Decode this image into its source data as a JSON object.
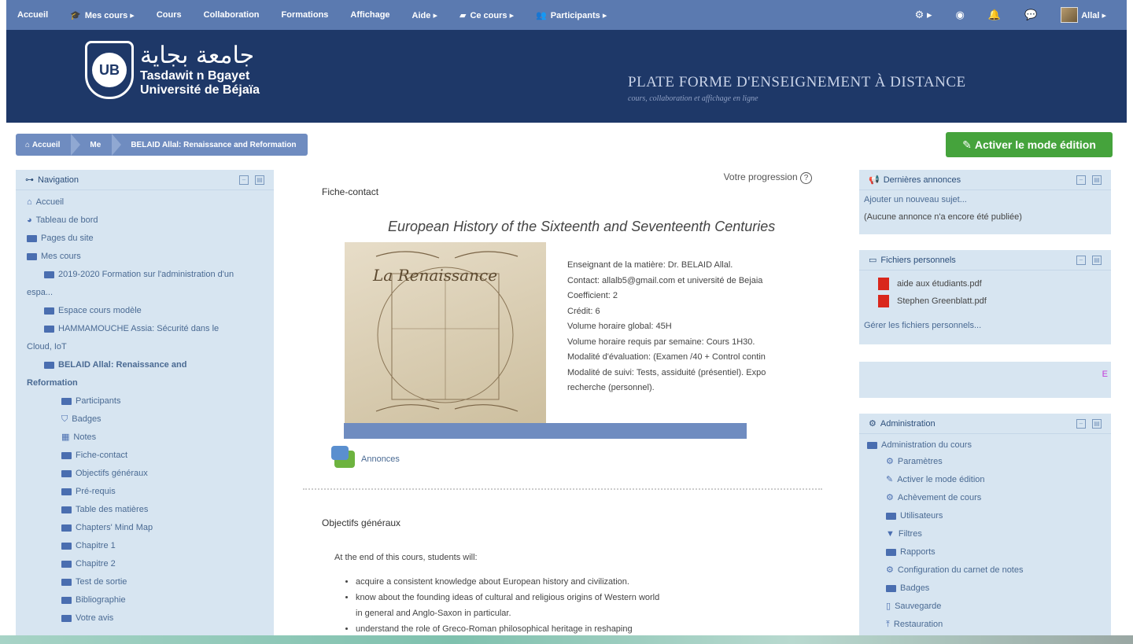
{
  "topbar": {
    "items": [
      {
        "label": "Accueil",
        "icon": ""
      },
      {
        "label": "Mes cours ▸",
        "icon": "mortarboard-icon"
      },
      {
        "label": "Cours",
        "icon": ""
      },
      {
        "label": "Collaboration",
        "icon": ""
      },
      {
        "label": "Formations",
        "icon": ""
      },
      {
        "label": "Affichage",
        "icon": ""
      },
      {
        "label": "Aide ▸",
        "icon": ""
      },
      {
        "label": "Ce cours ▸",
        "icon": "book-icon"
      },
      {
        "label": "Participants ▸",
        "icon": "users-icon"
      }
    ],
    "user_label": "Allal ▸"
  },
  "banner": {
    "arabic": "جامعة بجاية",
    "line1": "Tasdawit n Bgayet",
    "line2": "Université de Béjaïa",
    "title": "PLATE FORME D'ENSEIGNEMENT À DISTANCE",
    "subtitle": "cours, collaboration et affichage en ligne"
  },
  "breadcrumb": [
    "Accueil",
    "Me",
    "BELAID Allal: Renaissance and Reformation"
  ],
  "edit_button": "Activer le mode édition",
  "navigation": {
    "title": "Navigation",
    "items": [
      {
        "label": "Accueil",
        "indent": 0,
        "icon": "home"
      },
      {
        "label": "Tableau de bord",
        "indent": 0,
        "icon": "dashboard"
      },
      {
        "label": "Pages du site",
        "indent": 0,
        "icon": "folder"
      },
      {
        "label": "Mes cours",
        "indent": 0,
        "icon": "folder-open"
      },
      {
        "label": "2019-2020 Formation sur l'administration d'un",
        "indent": 1,
        "icon": "folder"
      },
      {
        "label": "espa...",
        "indent": 1,
        "icon": ""
      },
      {
        "label": "Espace cours modèle",
        "indent": 1,
        "icon": "folder"
      },
      {
        "label": "HAMMAMOUCHE Assia: Sécurité dans le",
        "indent": 1,
        "icon": "folder"
      },
      {
        "label": "Cloud, IoT",
        "indent": 1,
        "icon": ""
      },
      {
        "label": "BELAID Allal: Renaissance and",
        "indent": 1,
        "icon": "folder-open",
        "bold": true
      },
      {
        "label": "Reformation",
        "indent": 1,
        "icon": "",
        "bold": true
      },
      {
        "label": "Participants",
        "indent": 2,
        "icon": "folder"
      },
      {
        "label": "Badges",
        "indent": 2,
        "icon": "shield"
      },
      {
        "label": "Notes",
        "indent": 2,
        "icon": "table"
      },
      {
        "label": "Fiche-contact",
        "indent": 2,
        "icon": "folder"
      },
      {
        "label": "Objectifs généraux",
        "indent": 2,
        "icon": "folder"
      },
      {
        "label": "Pré-requis",
        "indent": 2,
        "icon": "folder"
      },
      {
        "label": "Table des matières",
        "indent": 2,
        "icon": "folder"
      },
      {
        "label": "Chapters' Mind Map",
        "indent": 2,
        "icon": "folder"
      },
      {
        "label": "Chapitre 1",
        "indent": 2,
        "icon": "folder"
      },
      {
        "label": "Chapitre 2",
        "indent": 2,
        "icon": "folder"
      },
      {
        "label": "Test de sortie",
        "indent": 2,
        "icon": "folder"
      },
      {
        "label": "Bibliographie",
        "indent": 2,
        "icon": "folder"
      },
      {
        "label": "Votre avis",
        "indent": 2,
        "icon": "folder"
      }
    ]
  },
  "main": {
    "progress_label": "Votre progression",
    "section1": "Fiche-contact",
    "course_title": "European History of the Sixteenth and Seventeenth Centuries",
    "image_text": "La Renaissance",
    "info": [
      "Enseignant de la matière: Dr. BELAID Allal.",
      "Contact: allalb5@gmail.com et université de Bejaia",
      "Coefficient: 2",
      "Crédit: 6",
      "Volume horaire global: 45H",
      "Volume horaire requis par semaine: Cours 1H30.",
      "Modalité d'évaluation: (Examen /40 + Control contin",
      "Modalité de suivi: Tests, assiduité (présentiel). Expo",
      "recherche (personnel)."
    ],
    "annonces": "Annonces",
    "section2": "Objectifs généraux",
    "obj_intro": "At the end of this cours, students will:",
    "objectives": [
      "acquire a consistent knowledge about European history and civilization.",
      "know about the founding ideas of cultural and religious origins of Western world",
      "in general and Anglo-Saxon in particular.",
      "understand the role of Greco-Roman philosophical heritage in reshaping"
    ]
  },
  "announcements": {
    "title": "Dernières annonces",
    "add": "Ajouter un nouveau sujet...",
    "none": "(Aucune annonce n'a encore été publiée)"
  },
  "files": {
    "title": "Fichiers personnels",
    "items": [
      "aide aux étudiants.pdf",
      "Stephen Greenblatt.pdf"
    ],
    "manage": "Gérer les fichiers personnels..."
  },
  "empty_block_char": "E",
  "admin": {
    "title": "Administration",
    "root": "Administration du cours",
    "items": [
      {
        "label": "Paramètres",
        "icon": "gear"
      },
      {
        "label": "Activer le mode édition",
        "icon": "pencil"
      },
      {
        "label": "Achèvement de cours",
        "icon": "gear"
      },
      {
        "label": "Utilisateurs",
        "icon": "folder"
      },
      {
        "label": "Filtres",
        "icon": "filter"
      },
      {
        "label": "Rapports",
        "icon": "folder"
      },
      {
        "label": "Configuration du carnet de notes",
        "icon": "gear"
      },
      {
        "label": "Badges",
        "icon": "folder"
      },
      {
        "label": "Sauvegarde",
        "icon": "file"
      },
      {
        "label": "Restauration",
        "icon": "upload"
      }
    ]
  },
  "colors": {
    "topbar": "#5b7ab0",
    "banner": "#1e3868",
    "block": "#d7e5f1",
    "edit_button": "#45a33c",
    "link": "#4a6a93"
  }
}
